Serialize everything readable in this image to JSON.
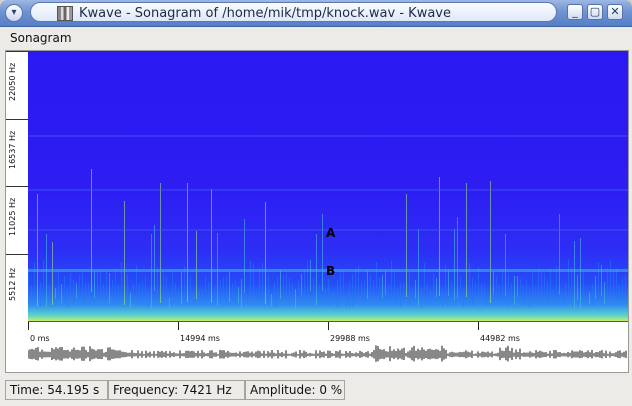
{
  "window": {
    "title": "Kwave - Sonagram of /home/mik/tmp/knock.wav - Kwave",
    "buttons": [
      "minimize",
      "maximize",
      "close"
    ],
    "button_glyphs": [
      "_",
      "▢",
      "✕"
    ]
  },
  "menu": {
    "items": [
      "Sonagram"
    ]
  },
  "frequency_axis": {
    "labels": [
      "22050 Hz",
      "16537 Hz",
      "11025 Hz",
      "5512 Hz"
    ]
  },
  "spectrogram": {
    "markers": [
      "A",
      "B"
    ]
  },
  "time_axis": {
    "labels": [
      "0 ms",
      "14994 ms",
      "29988 ms",
      "44982 ms"
    ]
  },
  "status": {
    "time": "Time: 54.195 s",
    "frequency": "Frequency: 7421 Hz",
    "amplitude": "Amplitude: 0 %"
  },
  "colors": {
    "title_blue": "#6f93d2",
    "spectrogram_background": "#2b19f1",
    "spectrogram_low": "#c6ee63"
  },
  "icons": {
    "window_menu": "chevron-down-icon",
    "app": "kwave-app-icon"
  }
}
